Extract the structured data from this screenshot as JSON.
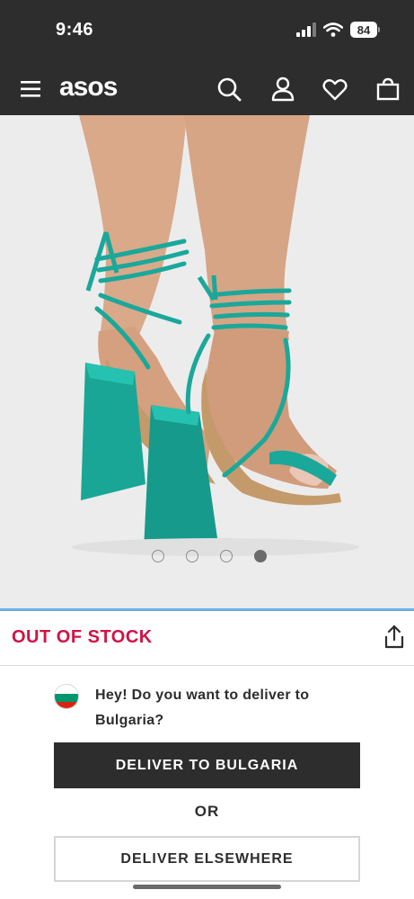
{
  "status_bar": {
    "time": "9:46",
    "battery": "84",
    "icons": [
      "signal-icon",
      "wifi-icon",
      "battery-icon"
    ]
  },
  "header": {
    "logo": "asos",
    "icons": [
      "menu-icon",
      "search-icon",
      "account-icon",
      "heart-icon",
      "bag-icon"
    ]
  },
  "product_image": {
    "subject": "teal lace-up heeled sandals",
    "carousel_total": 4,
    "carousel_active": 4
  },
  "stock": {
    "status": "OUT OF STOCK",
    "status_color": "#d01345",
    "share_icon": "share-icon"
  },
  "delivery": {
    "question": "Hey! Do you want to deliver to Bulgaria?",
    "primary_button": "DELIVER TO BULGARIA",
    "or_text": "OR",
    "secondary_button": "DELIVER ELSEWHERE"
  },
  "colors": {
    "header_bg": "#2d2d2d",
    "accent_blue": "#6ab0e8",
    "sandal_teal": "#1aa89a"
  }
}
